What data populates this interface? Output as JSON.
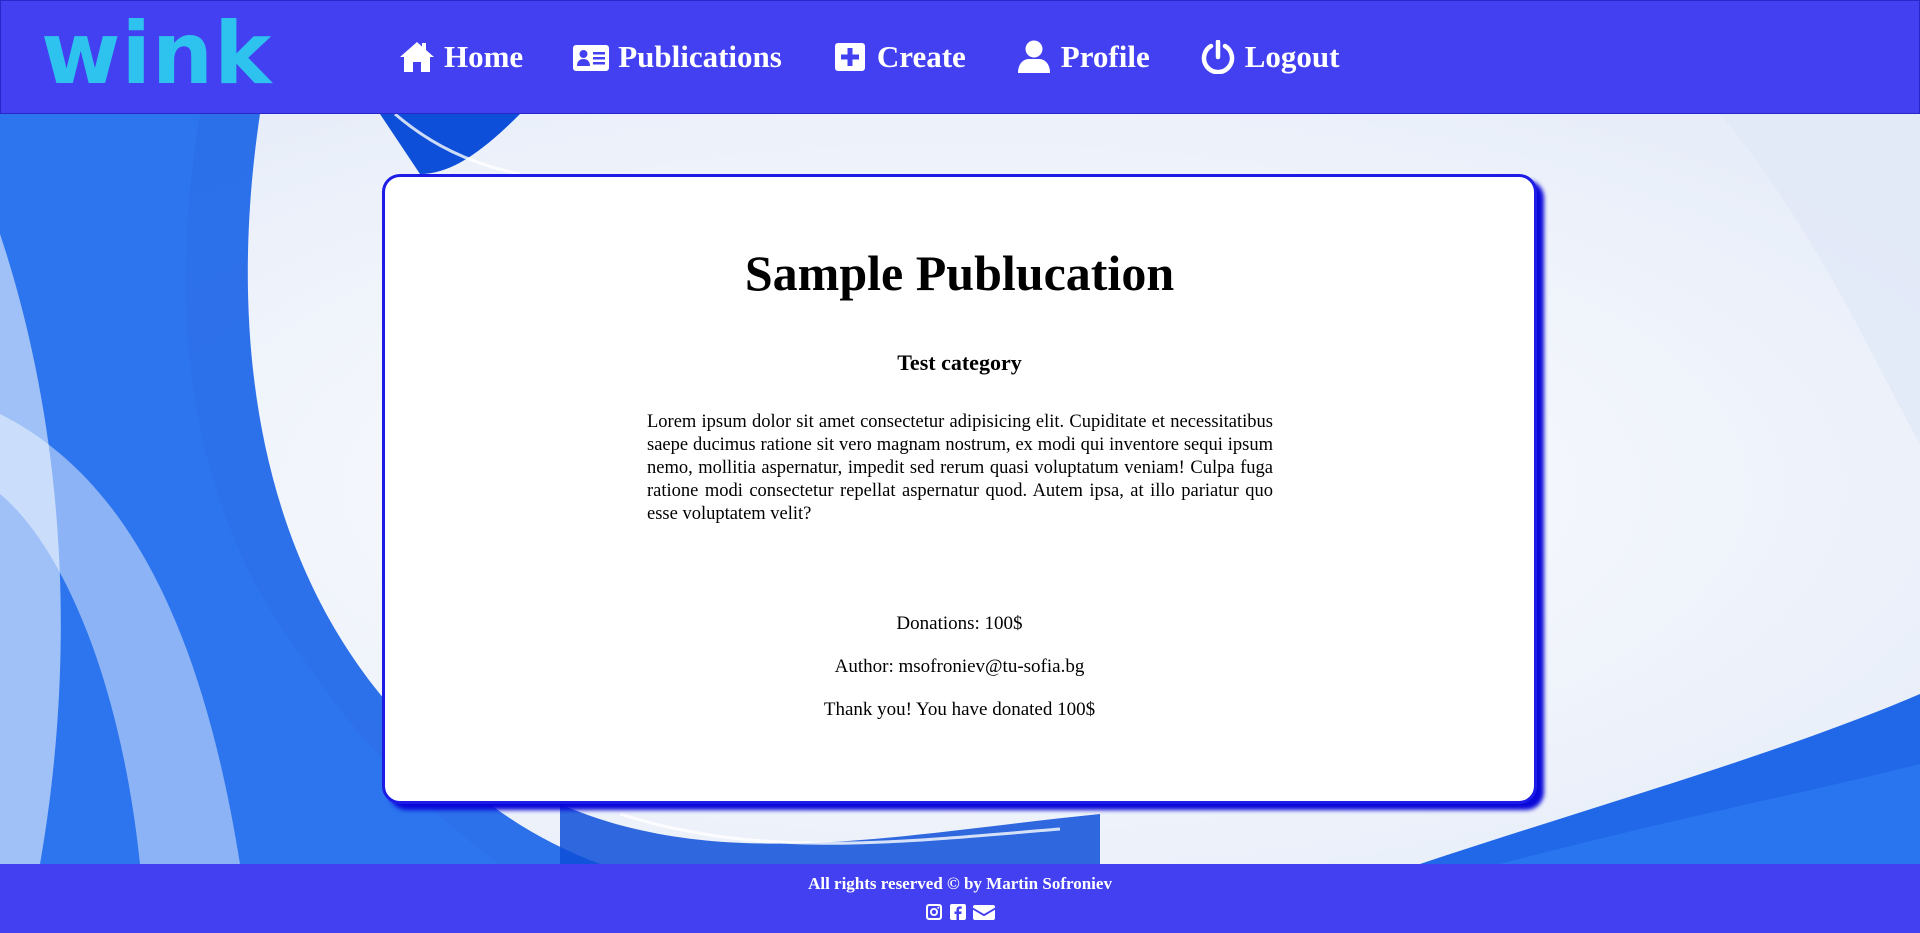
{
  "brand": {
    "logo_text": "wink",
    "logo_color": "#2ec3ee",
    "bar_color": "#4340f2"
  },
  "nav": {
    "items": [
      {
        "label": "Home",
        "icon": "home-icon"
      },
      {
        "label": "Publications",
        "icon": "id-card-icon"
      },
      {
        "label": "Create",
        "icon": "plus-square-icon"
      },
      {
        "label": "Profile",
        "icon": "user-icon"
      },
      {
        "label": "Logout",
        "icon": "power-icon"
      }
    ]
  },
  "publication": {
    "title": "Sample Publucation",
    "category": "Test category",
    "body": "Lorem ipsum dolor sit amet consectetur adipisicing elit. Cupiditate et necessitatibus saepe ducimus ratione sit vero magnam nostrum, ex modi qui inventore sequi ipsum nemo, mollitia aspernatur, impedit sed rerum quasi voluptatum veniam! Culpa fuga ratione modi consectetur repellat aspernatur quod. Autem ipsa, at illo pariatur quo esse voluptatem velit?",
    "donations": "Donations: 100$",
    "author": "Author: msofroniev@tu-sofia.bg",
    "thank_you": "Thank you! You have donated 100$"
  },
  "footer": {
    "text": "All rights reserved © by Martin Sofroniev",
    "social": [
      "instagram-icon",
      "facebook-icon",
      "envelope-icon"
    ]
  }
}
